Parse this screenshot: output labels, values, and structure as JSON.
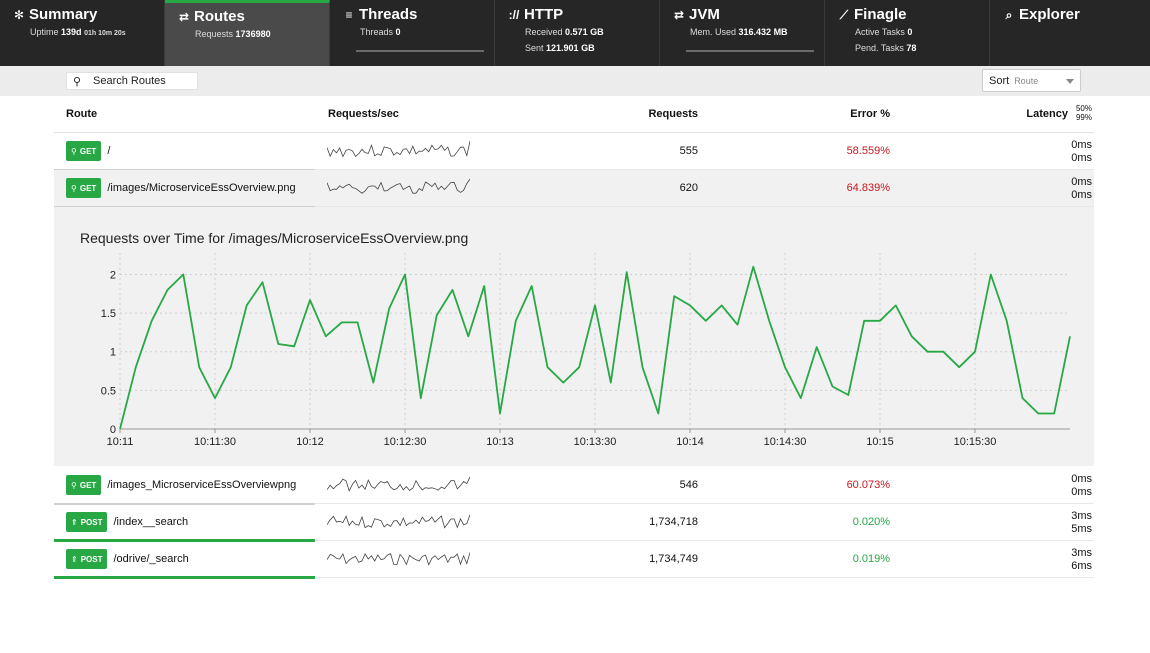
{
  "nav": {
    "tabs": [
      {
        "key": "summary",
        "icon": "summary-icon",
        "glyph": "✻",
        "title": "Summary",
        "lines": [
          {
            "label": "Uptime",
            "value": "139d",
            "extra": "01h 10m 20s"
          }
        ],
        "active": false,
        "bar": false
      },
      {
        "key": "routes",
        "icon": "routes-icon",
        "glyph": "⇄",
        "title": "Routes",
        "lines": [
          {
            "label": "Requests",
            "value": "1736980"
          }
        ],
        "active": true,
        "bar": false
      },
      {
        "key": "threads",
        "icon": "threads-icon",
        "glyph": "≡",
        "title": "Threads",
        "lines": [
          {
            "label": "Threads",
            "value": "0"
          }
        ],
        "active": false,
        "bar": true
      },
      {
        "key": "http",
        "icon": "http-icon",
        "glyph": "://",
        "title": "HTTP",
        "lines": [
          {
            "label": "Received",
            "value": "0.571 GB"
          },
          {
            "label": "Sent",
            "value": "121.901 GB"
          }
        ],
        "active": false,
        "bar": false
      },
      {
        "key": "jvm",
        "icon": "jvm-icon",
        "glyph": "⇄",
        "title": "JVM",
        "lines": [
          {
            "label": "Mem. Used",
            "value": "316.432 MB"
          }
        ],
        "active": false,
        "bar": true
      },
      {
        "key": "finagle",
        "icon": "finagle-icon",
        "glyph": "⟋",
        "title": "Finagle",
        "lines": [
          {
            "label": "Active Tasks",
            "value": "0"
          },
          {
            "label": "Pend. Tasks",
            "value": "78"
          }
        ],
        "active": false,
        "bar": false
      },
      {
        "key": "explorer",
        "icon": "explorer-icon",
        "glyph": "⌕",
        "title": "Explorer",
        "lines": [],
        "active": false,
        "bar": false
      }
    ]
  },
  "toolbar": {
    "search_placeholder": "Search Routes",
    "sort_label": "Sort",
    "sort_value": "Route"
  },
  "table": {
    "headers": {
      "route": "Route",
      "rps": "Requests/sec",
      "requests": "Requests",
      "error": "Error %",
      "latency": "Latency",
      "lat_p50": "50%",
      "lat_p99": "99%"
    },
    "rows": [
      {
        "method": "GET",
        "path": "/",
        "requests": "555",
        "error": "58.559%",
        "error_state": "bad",
        "p50": "0ms",
        "p99": "0ms",
        "selected": false,
        "underline": "gray"
      },
      {
        "method": "GET",
        "path": "/images/MicroserviceEssOverview.png",
        "requests": "620",
        "error": "64.839%",
        "error_state": "bad",
        "p50": "0ms",
        "p99": "0ms",
        "selected": true,
        "underline": "gray"
      },
      {
        "method": "GET",
        "path": "/images_MicroserviceEssOverviewpng",
        "requests": "546",
        "error": "60.073%",
        "error_state": "bad",
        "p50": "0ms",
        "p99": "0ms",
        "selected": false,
        "underline": "gray"
      },
      {
        "method": "POST",
        "path": "/index__search",
        "requests": "1,734,718",
        "error": "0.020%",
        "error_state": "good",
        "p50": "3ms",
        "p99": "5ms",
        "selected": false,
        "underline": "green"
      },
      {
        "method": "POST",
        "path": "/odrive/_search",
        "requests": "1,734,749",
        "error": "0.019%",
        "error_state": "good",
        "p50": "3ms",
        "p99": "6ms",
        "selected": false,
        "underline": "green"
      }
    ]
  },
  "colors": {
    "accent": "#27a844",
    "error": "#c9171e",
    "line": "#27a844"
  },
  "chart_data": {
    "type": "line",
    "title": "Requests over Time for /images/MicroserviceEssOverview.png",
    "xlabel": "",
    "ylabel": "",
    "ylim": [
      0,
      2.2
    ],
    "yticks": [
      0,
      0.5,
      1,
      1.5,
      2
    ],
    "ytick_labels": [
      "0",
      "0.5",
      "1",
      "1.5",
      "2"
    ],
    "x_start": "10:11:00",
    "x_step_seconds": 5,
    "xticks": [
      "10:11",
      "10:11:30",
      "10:12",
      "10:12:30",
      "10:13",
      "10:13:30",
      "10:14",
      "10:14:30",
      "10:15",
      "10:15:30"
    ],
    "grid": true,
    "series": [
      {
        "values": [
          0,
          0.8,
          1.4,
          1.8,
          2,
          0.8,
          0.4,
          0.8,
          1.6,
          1.9,
          1.1,
          1.07,
          1.67,
          1.2,
          1.38,
          1.38,
          0.6,
          1.56,
          2,
          0.4,
          1.47,
          1.8,
          1.2,
          1.85,
          0.2,
          1.4,
          1.85,
          0.8,
          0.6,
          0.8,
          1.6,
          0.6,
          2.03,
          0.8,
          0.2,
          1.72,
          1.6,
          1.4,
          1.6,
          1.35,
          2.1,
          1.4,
          0.8,
          0.4,
          1.06,
          0.55,
          0.44,
          1.4,
          1.4,
          1.6,
          1.2,
          1.0,
          1.0,
          0.8,
          1.0,
          2.0,
          1.4,
          0.4,
          0.2,
          0.2,
          1.2
        ]
      }
    ]
  }
}
